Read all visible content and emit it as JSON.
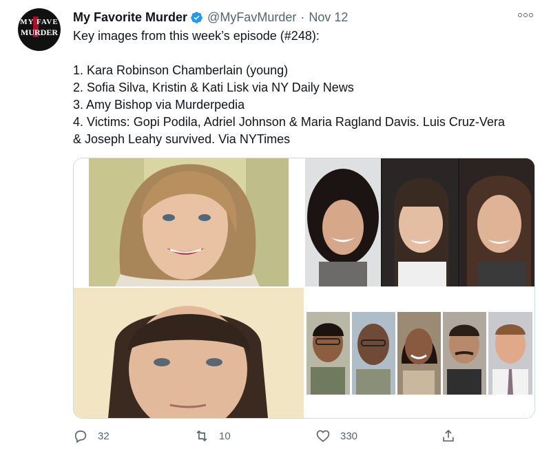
{
  "author": {
    "name": "My Favorite Murder",
    "handle": "@MyFavMurder",
    "separator": "·",
    "date": "Nov 12",
    "avatar_logo_top": "MY FAVE",
    "avatar_logo_bottom": "MURDER"
  },
  "tweet": {
    "lines": [
      "Key images from this week’s episode (#248):",
      "",
      "1. Kara Robinson Chamberlain (young)",
      "2. Sofia Silva, Kristin & Kati Lisk via NY Daily News",
      "3. Amy Bishop via Murderpedia",
      "4. Victims: Gopi Podila, Adriel Johnson & Maria Ragland Davis. Luis Cruz-Vera",
      "& Joseph Leahy survived. Via NYTimes"
    ]
  },
  "media": {
    "images": [
      {
        "name": "Kara Robinson Chamberlain photo",
        "icon": "portrait-photo"
      },
      {
        "name": "Sofia Silva, Kristin & Kati Lisk photo",
        "icon": "portrait-photo"
      },
      {
        "name": "Amy Bishop photo",
        "icon": "portrait-photo"
      },
      {
        "name": "Victims photo row",
        "icon": "portrait-photo"
      }
    ]
  },
  "actions": {
    "reply_count": "32",
    "retweet_count": "10",
    "like_count": "330",
    "share_label": ""
  },
  "colors": {
    "verified": "#1d9bf0",
    "muted": "#536471",
    "text": "#0f1419",
    "border": "#cfd9de"
  }
}
